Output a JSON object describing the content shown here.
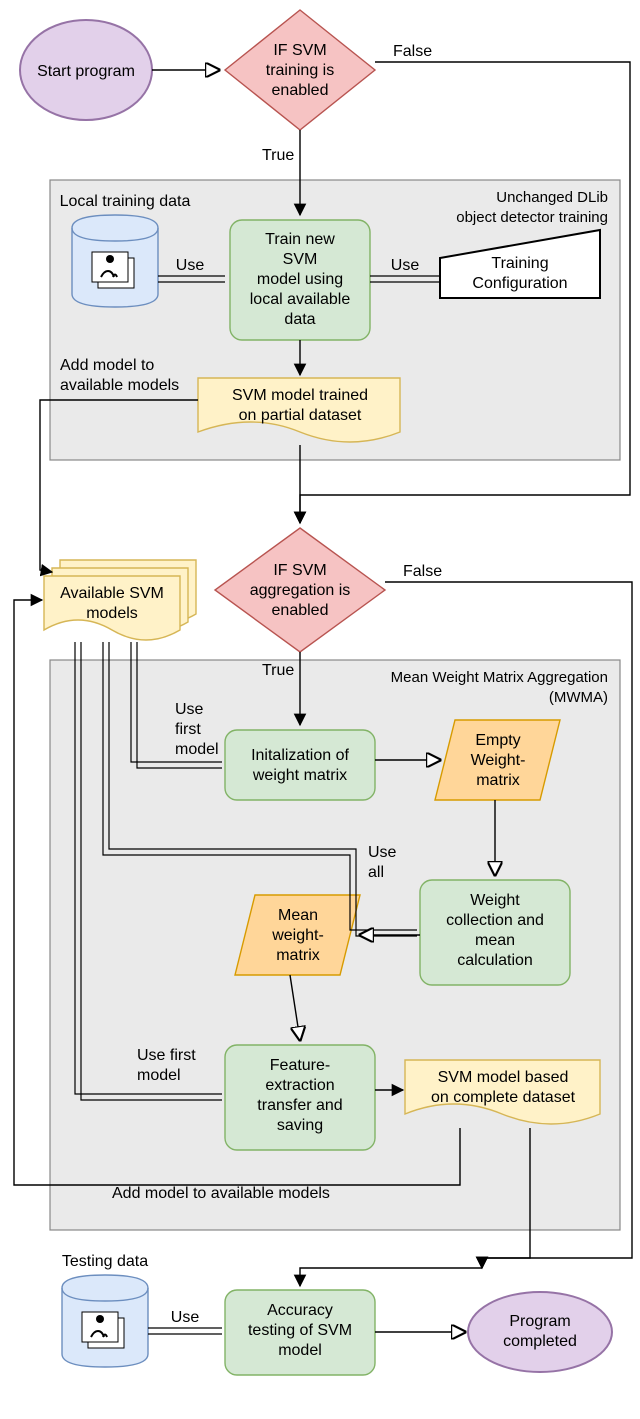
{
  "chart_data": {
    "type": "flowchart",
    "nodes": [
      {
        "id": "start",
        "kind": "start-end",
        "text": "Start program"
      },
      {
        "id": "dec_train",
        "kind": "decision",
        "text": "IF SVM training is enabled"
      },
      {
        "id": "local_data",
        "kind": "database",
        "text": "Local training data"
      },
      {
        "id": "train_model",
        "kind": "process",
        "text": "Train new SVM model using local available data"
      },
      {
        "id": "train_cfg",
        "kind": "manual-input",
        "text": "Training Configuration"
      },
      {
        "id": "partial_doc",
        "kind": "document",
        "text": "SVM model trained on partial dataset"
      },
      {
        "id": "avail_models",
        "kind": "multi-document",
        "text": "Available SVM models"
      },
      {
        "id": "dec_agg",
        "kind": "decision",
        "text": "IF SVM aggregation is enabled"
      },
      {
        "id": "init_wm",
        "kind": "process",
        "text": "Initalization of weight matrix"
      },
      {
        "id": "empty_wm",
        "kind": "data",
        "text": "Empty Weight-matrix"
      },
      {
        "id": "wcollect",
        "kind": "process",
        "text": "Weight collection and mean calculation"
      },
      {
        "id": "mean_wm",
        "kind": "data",
        "text": "Mean weight-matrix"
      },
      {
        "id": "featex",
        "kind": "process",
        "text": "Feature-extraction transfer and saving"
      },
      {
        "id": "full_doc",
        "kind": "document",
        "text": "SVM model based on complete dataset"
      },
      {
        "id": "test_data",
        "kind": "database",
        "text": "Testing data"
      },
      {
        "id": "acc_test",
        "kind": "process",
        "text": "Accuracy testing of SVM model"
      },
      {
        "id": "done",
        "kind": "start-end",
        "text": "Program completed"
      }
    ],
    "edges": [
      {
        "from": "start",
        "to": "dec_train",
        "label": ""
      },
      {
        "from": "dec_train",
        "to": "train_model",
        "label": "True"
      },
      {
        "from": "dec_train",
        "to": "down_right",
        "label": "False"
      },
      {
        "from": "local_data",
        "to": "train_model",
        "label": "Use",
        "style": "double"
      },
      {
        "from": "train_cfg",
        "to": "train_model",
        "label": "Use",
        "style": "double"
      },
      {
        "from": "train_model",
        "to": "partial_doc",
        "label": ""
      },
      {
        "from": "partial_doc",
        "to": "avail_models",
        "label": "Add model to available models"
      },
      {
        "from": "partial_doc",
        "to": "dec_agg",
        "label": ""
      },
      {
        "from": "dec_agg",
        "to": "init_wm",
        "label": "True"
      },
      {
        "from": "dec_agg",
        "to": "down_right2",
        "label": "False"
      },
      {
        "from": "avail_models",
        "to": "init_wm",
        "label": "Use first model",
        "style": "double"
      },
      {
        "from": "init_wm",
        "to": "empty_wm",
        "label": ""
      },
      {
        "from": "empty_wm",
        "to": "wcollect",
        "label": ""
      },
      {
        "from": "avail_models",
        "to": "wcollect",
        "label": "Use all",
        "style": "double"
      },
      {
        "from": "wcollect",
        "to": "mean_wm",
        "label": ""
      },
      {
        "from": "mean_wm",
        "to": "featex",
        "label": ""
      },
      {
        "from": "avail_models",
        "to": "featex",
        "label": "Use first model",
        "style": "double"
      },
      {
        "from": "featex",
        "to": "full_doc",
        "label": ""
      },
      {
        "from": "full_doc",
        "to": "avail_models",
        "label": "Add model to available models"
      },
      {
        "from": "full_doc",
        "to": "acc_test",
        "label": ""
      },
      {
        "from": "test_data",
        "to": "acc_test",
        "label": "Use",
        "style": "double"
      },
      {
        "from": "acc_test",
        "to": "done",
        "label": ""
      }
    ],
    "groups": [
      {
        "id": "g1",
        "label": "Unchanged DLib object detector training",
        "contains": [
          "local_data",
          "train_model",
          "train_cfg",
          "partial_doc"
        ]
      },
      {
        "id": "g2",
        "label": "Mean Weight Matrix Aggregation (MWMA)",
        "contains": [
          "init_wm",
          "empty_wm",
          "wcollect",
          "mean_wm",
          "featex",
          "full_doc"
        ]
      }
    ]
  },
  "colors": {
    "start_end": "#e2d0ea",
    "decision": "#f6c3c3",
    "process": "#d5e8d4",
    "database": "#dbe8fa",
    "document": "#fff2c8",
    "data": "#ffd699",
    "manual": "#ffffff",
    "group": "#eaeaea",
    "doc_border": "#d6b656",
    "data_border": "#d79b00",
    "proc_border": "#82b366",
    "dec_border": "#b85450",
    "se_border": "#9673a6",
    "db_border": "#6c8ebf"
  },
  "labels": {
    "start": [
      "Start program"
    ],
    "dec_train": [
      "IF SVM",
      "training is",
      "enabled"
    ],
    "local_data": [
      "Local training data"
    ],
    "train_model": [
      "Train new",
      "SVM",
      "model using",
      "local available",
      "data"
    ],
    "train_cfg": [
      "Training",
      "Configuration"
    ],
    "partial_doc": [
      "SVM model trained",
      "on partial dataset"
    ],
    "add_model1": [
      "Add model to",
      "available models"
    ],
    "avail_models": [
      "Available SVM",
      "models"
    ],
    "dec_agg": [
      "IF SVM",
      "aggregation is",
      "enabled"
    ],
    "init_wm": [
      "Initalization of",
      "weight matrix"
    ],
    "empty_wm": [
      "Empty",
      "Weight-",
      "matrix"
    ],
    "wcollect": [
      "Weight",
      "collection and",
      "mean",
      "calculation"
    ],
    "mean_wm": [
      "Mean",
      "weight-",
      "matrix"
    ],
    "featex": [
      "Feature-",
      "extraction",
      "transfer and",
      "saving"
    ],
    "full_doc": [
      "SVM model based",
      "on complete dataset"
    ],
    "add_model2": [
      "Add model to available models"
    ],
    "test_data": [
      "Testing data"
    ],
    "acc_test": [
      "Accuracy",
      "testing of SVM",
      "model"
    ],
    "done": [
      "Program",
      "completed"
    ],
    "group1": [
      "Unchanged DLib",
      "object detector training"
    ],
    "group2": [
      "Mean Weight Matrix Aggregation",
      "(MWMA)"
    ],
    "edge_true": "True",
    "edge_false": "False",
    "edge_use": "Use",
    "edge_use_first": [
      "Use",
      "first",
      "model"
    ],
    "edge_use_first2": [
      "Use first",
      "model"
    ],
    "edge_use_all": [
      "Use",
      "all"
    ]
  }
}
